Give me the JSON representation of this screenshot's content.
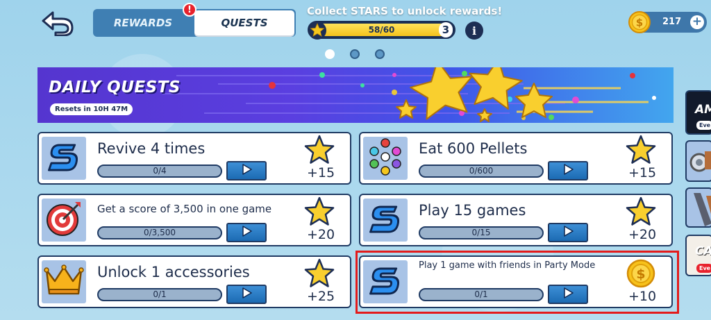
{
  "header": {
    "tabs": [
      {
        "label": "REWARDS",
        "active": false
      },
      {
        "label": "QUESTS",
        "active": true
      }
    ],
    "alert_badge": "!",
    "collect_text": "Collect STARS to unlock rewards!",
    "progress": {
      "text": "58/60",
      "current": 58,
      "max": 60,
      "level": "3"
    },
    "info_label": "i",
    "coins": "217",
    "coin_plus": "+"
  },
  "pager": {
    "pages": 3,
    "active_index": 0
  },
  "banner": {
    "title": "DAILY QUESTS",
    "resets": "Resets in 10H 47M"
  },
  "quests": [
    {
      "icon": "s-logo-icon",
      "title": "Revive 4 times",
      "progress": "0/4",
      "reward_icon": "star-icon",
      "reward": "+15"
    },
    {
      "icon": "pellets-icon",
      "title": "Eat 600 Pellets",
      "progress": "0/600",
      "reward_icon": "star-icon",
      "reward": "+15"
    },
    {
      "icon": "target-icon",
      "title": "Get a score of 3,500 in one game",
      "progress": "0/3,500",
      "reward_icon": "star-icon",
      "reward": "+20"
    },
    {
      "icon": "s-logo-icon",
      "title": "Play 15 games",
      "progress": "0/15",
      "reward_icon": "star-icon",
      "reward": "+20"
    },
    {
      "icon": "crown-icon",
      "title": "Unlock 1 accessories",
      "progress": "0/1",
      "reward_icon": "star-icon",
      "reward": "+25"
    },
    {
      "icon": "s-logo-icon",
      "title": "Play 1 game with friends in Party Mode",
      "progress": "0/1",
      "reward_icon": "coin-icon",
      "reward": "+10"
    }
  ],
  "side_panel": {
    "card1_title": "AM",
    "card1_sub": "Eve",
    "card4_title": "CA",
    "card4_sub": "Eve"
  },
  "colors": {
    "accent": "#1c6bb3",
    "highlight": "#e31b1b",
    "star": "#f5c61d",
    "banner_start": "#5535cf",
    "banner_end": "#42a6ee"
  }
}
